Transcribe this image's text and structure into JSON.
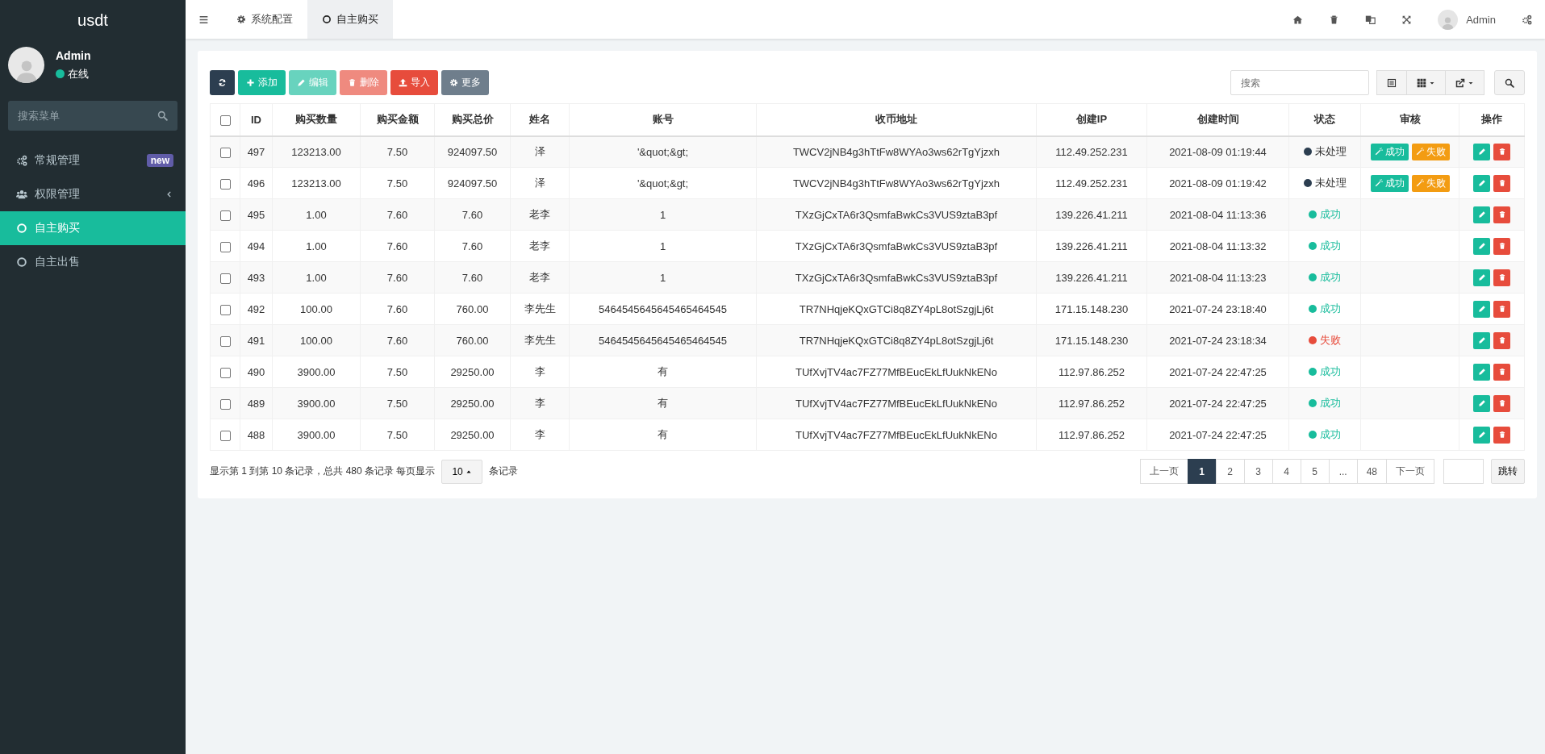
{
  "sidebar": {
    "logo": "usdt",
    "user": {
      "name": "Admin",
      "status": "在线"
    },
    "search": {
      "placeholder": "搜索菜单"
    },
    "items": [
      {
        "label": "常规管理",
        "badge": "new",
        "expandable": false,
        "selected": false
      },
      {
        "label": "权限管理",
        "expandable": true,
        "selected": false
      },
      {
        "label": "自主购买",
        "expandable": false,
        "selected": true
      },
      {
        "label": "自主出售",
        "expandable": false,
        "selected": false
      }
    ]
  },
  "header": {
    "tabs": [
      {
        "label": "系统配置",
        "selected": false
      },
      {
        "label": "自主购买",
        "selected": true
      }
    ],
    "user": "Admin"
  },
  "toolbar": {
    "buttons": [
      {
        "kind": "refresh",
        "disabled": false
      },
      {
        "kind": "add",
        "label": "添加",
        "disabled": false
      },
      {
        "kind": "edit",
        "label": "编辑",
        "disabled": true
      },
      {
        "kind": "delete",
        "label": "删除",
        "disabled": true
      },
      {
        "kind": "import",
        "label": "导入",
        "disabled": false
      },
      {
        "kind": "more",
        "label": "更多",
        "disabled": false
      }
    ],
    "search": {
      "placeholder": "搜索"
    }
  },
  "table": {
    "header_checkbox": {
      "checked": false
    },
    "columns": [
      "ID",
      "购买数量",
      "购买金额",
      "购买总价",
      "姓名",
      "账号",
      "收币地址",
      "创建IP",
      "创建时间",
      "状态",
      "审核",
      "操作"
    ],
    "rows": [
      {
        "checked": false,
        "id": "497",
        "qty": "123213.00",
        "amount": "7.50",
        "total": "924097.50",
        "name": "泽",
        "account": "'&quot;&gt;",
        "address": "TWCV2jNB4g3hTtFw8WYAo3ws62rTgYjzxh",
        "ip": "112.49.252.231",
        "time": "2021-08-09 01:19:44",
        "status": {
          "label": "未处理",
          "kind": "pending"
        },
        "review": [
          {
            "label": "成功",
            "kind": "success"
          },
          {
            "label": "失败",
            "kind": "fail"
          }
        ]
      },
      {
        "checked": false,
        "id": "496",
        "qty": "123213.00",
        "amount": "7.50",
        "total": "924097.50",
        "name": "泽",
        "account": "'&quot;&gt;",
        "address": "TWCV2jNB4g3hTtFw8WYAo3ws62rTgYjzxh",
        "ip": "112.49.252.231",
        "time": "2021-08-09 01:19:42",
        "status": {
          "label": "未处理",
          "kind": "pending"
        },
        "review": [
          {
            "label": "成功",
            "kind": "success"
          },
          {
            "label": "失败",
            "kind": "fail"
          }
        ]
      },
      {
        "checked": false,
        "id": "495",
        "qty": "1.00",
        "amount": "7.60",
        "total": "7.60",
        "name": "老李",
        "account": "1",
        "address": "TXzGjCxTA6r3QsmfaBwkCs3VUS9ztaB3pf",
        "ip": "139.226.41.211",
        "time": "2021-08-04 11:13:36",
        "status": {
          "label": "成功",
          "kind": "success"
        }
      },
      {
        "checked": false,
        "id": "494",
        "qty": "1.00",
        "amount": "7.60",
        "total": "7.60",
        "name": "老李",
        "account": "1",
        "address": "TXzGjCxTA6r3QsmfaBwkCs3VUS9ztaB3pf",
        "ip": "139.226.41.211",
        "time": "2021-08-04 11:13:32",
        "status": {
          "label": "成功",
          "kind": "success"
        }
      },
      {
        "checked": false,
        "id": "493",
        "qty": "1.00",
        "amount": "7.60",
        "total": "7.60",
        "name": "老李",
        "account": "1",
        "address": "TXzGjCxTA6r3QsmfaBwkCs3VUS9ztaB3pf",
        "ip": "139.226.41.211",
        "time": "2021-08-04 11:13:23",
        "status": {
          "label": "成功",
          "kind": "success"
        }
      },
      {
        "checked": false,
        "id": "492",
        "qty": "100.00",
        "amount": "7.60",
        "total": "760.00",
        "name": "李先生",
        "account": "5464545645645465464545",
        "address": "TR7NHqjeKQxGTCi8q8ZY4pL8otSzgjLj6t",
        "ip": "171.15.148.230",
        "time": "2021-07-24 23:18:40",
        "status": {
          "label": "成功",
          "kind": "success"
        }
      },
      {
        "checked": false,
        "id": "491",
        "qty": "100.00",
        "amount": "7.60",
        "total": "760.00",
        "name": "李先生",
        "account": "5464545645645465464545",
        "address": "TR7NHqjeKQxGTCi8q8ZY4pL8otSzgjLj6t",
        "ip": "171.15.148.230",
        "time": "2021-07-24 23:18:34",
        "status": {
          "label": "失败",
          "kind": "fail"
        }
      },
      {
        "checked": false,
        "id": "490",
        "qty": "3900.00",
        "amount": "7.50",
        "total": "29250.00",
        "name": "李",
        "account": "有",
        "address": "TUfXvjTV4ac7FZ77MfBEucEkLfUukNkENo",
        "ip": "112.97.86.252",
        "time": "2021-07-24 22:47:25",
        "status": {
          "label": "成功",
          "kind": "success"
        }
      },
      {
        "checked": false,
        "id": "489",
        "qty": "3900.00",
        "amount": "7.50",
        "total": "29250.00",
        "name": "李",
        "account": "有",
        "address": "TUfXvjTV4ac7FZ77MfBEucEkLfUukNkENo",
        "ip": "112.97.86.252",
        "time": "2021-07-24 22:47:25",
        "status": {
          "label": "成功",
          "kind": "success"
        }
      },
      {
        "checked": false,
        "id": "488",
        "qty": "3900.00",
        "amount": "7.50",
        "total": "29250.00",
        "name": "李",
        "account": "有",
        "address": "TUfXvjTV4ac7FZ77MfBEucEkLfUukNkENo",
        "ip": "112.97.86.252",
        "time": "2021-07-24 22:47:25",
        "status": {
          "label": "成功",
          "kind": "success"
        }
      }
    ]
  },
  "footer": {
    "summary": "显示第 1 到第 10 条记录，总共 480 条记录 每页显示",
    "page_size": "10",
    "suffix": "条记录",
    "pages": [
      {
        "label": "上一页",
        "selected": false
      },
      {
        "label": "1",
        "selected": true
      },
      {
        "label": "2",
        "selected": false
      },
      {
        "label": "3",
        "selected": false
      },
      {
        "label": "4",
        "selected": false
      },
      {
        "label": "5",
        "selected": false
      },
      {
        "label": "...",
        "selected": false
      },
      {
        "label": "48",
        "selected": false
      },
      {
        "label": "下一页",
        "selected": false
      }
    ],
    "jump": "跳转"
  }
}
